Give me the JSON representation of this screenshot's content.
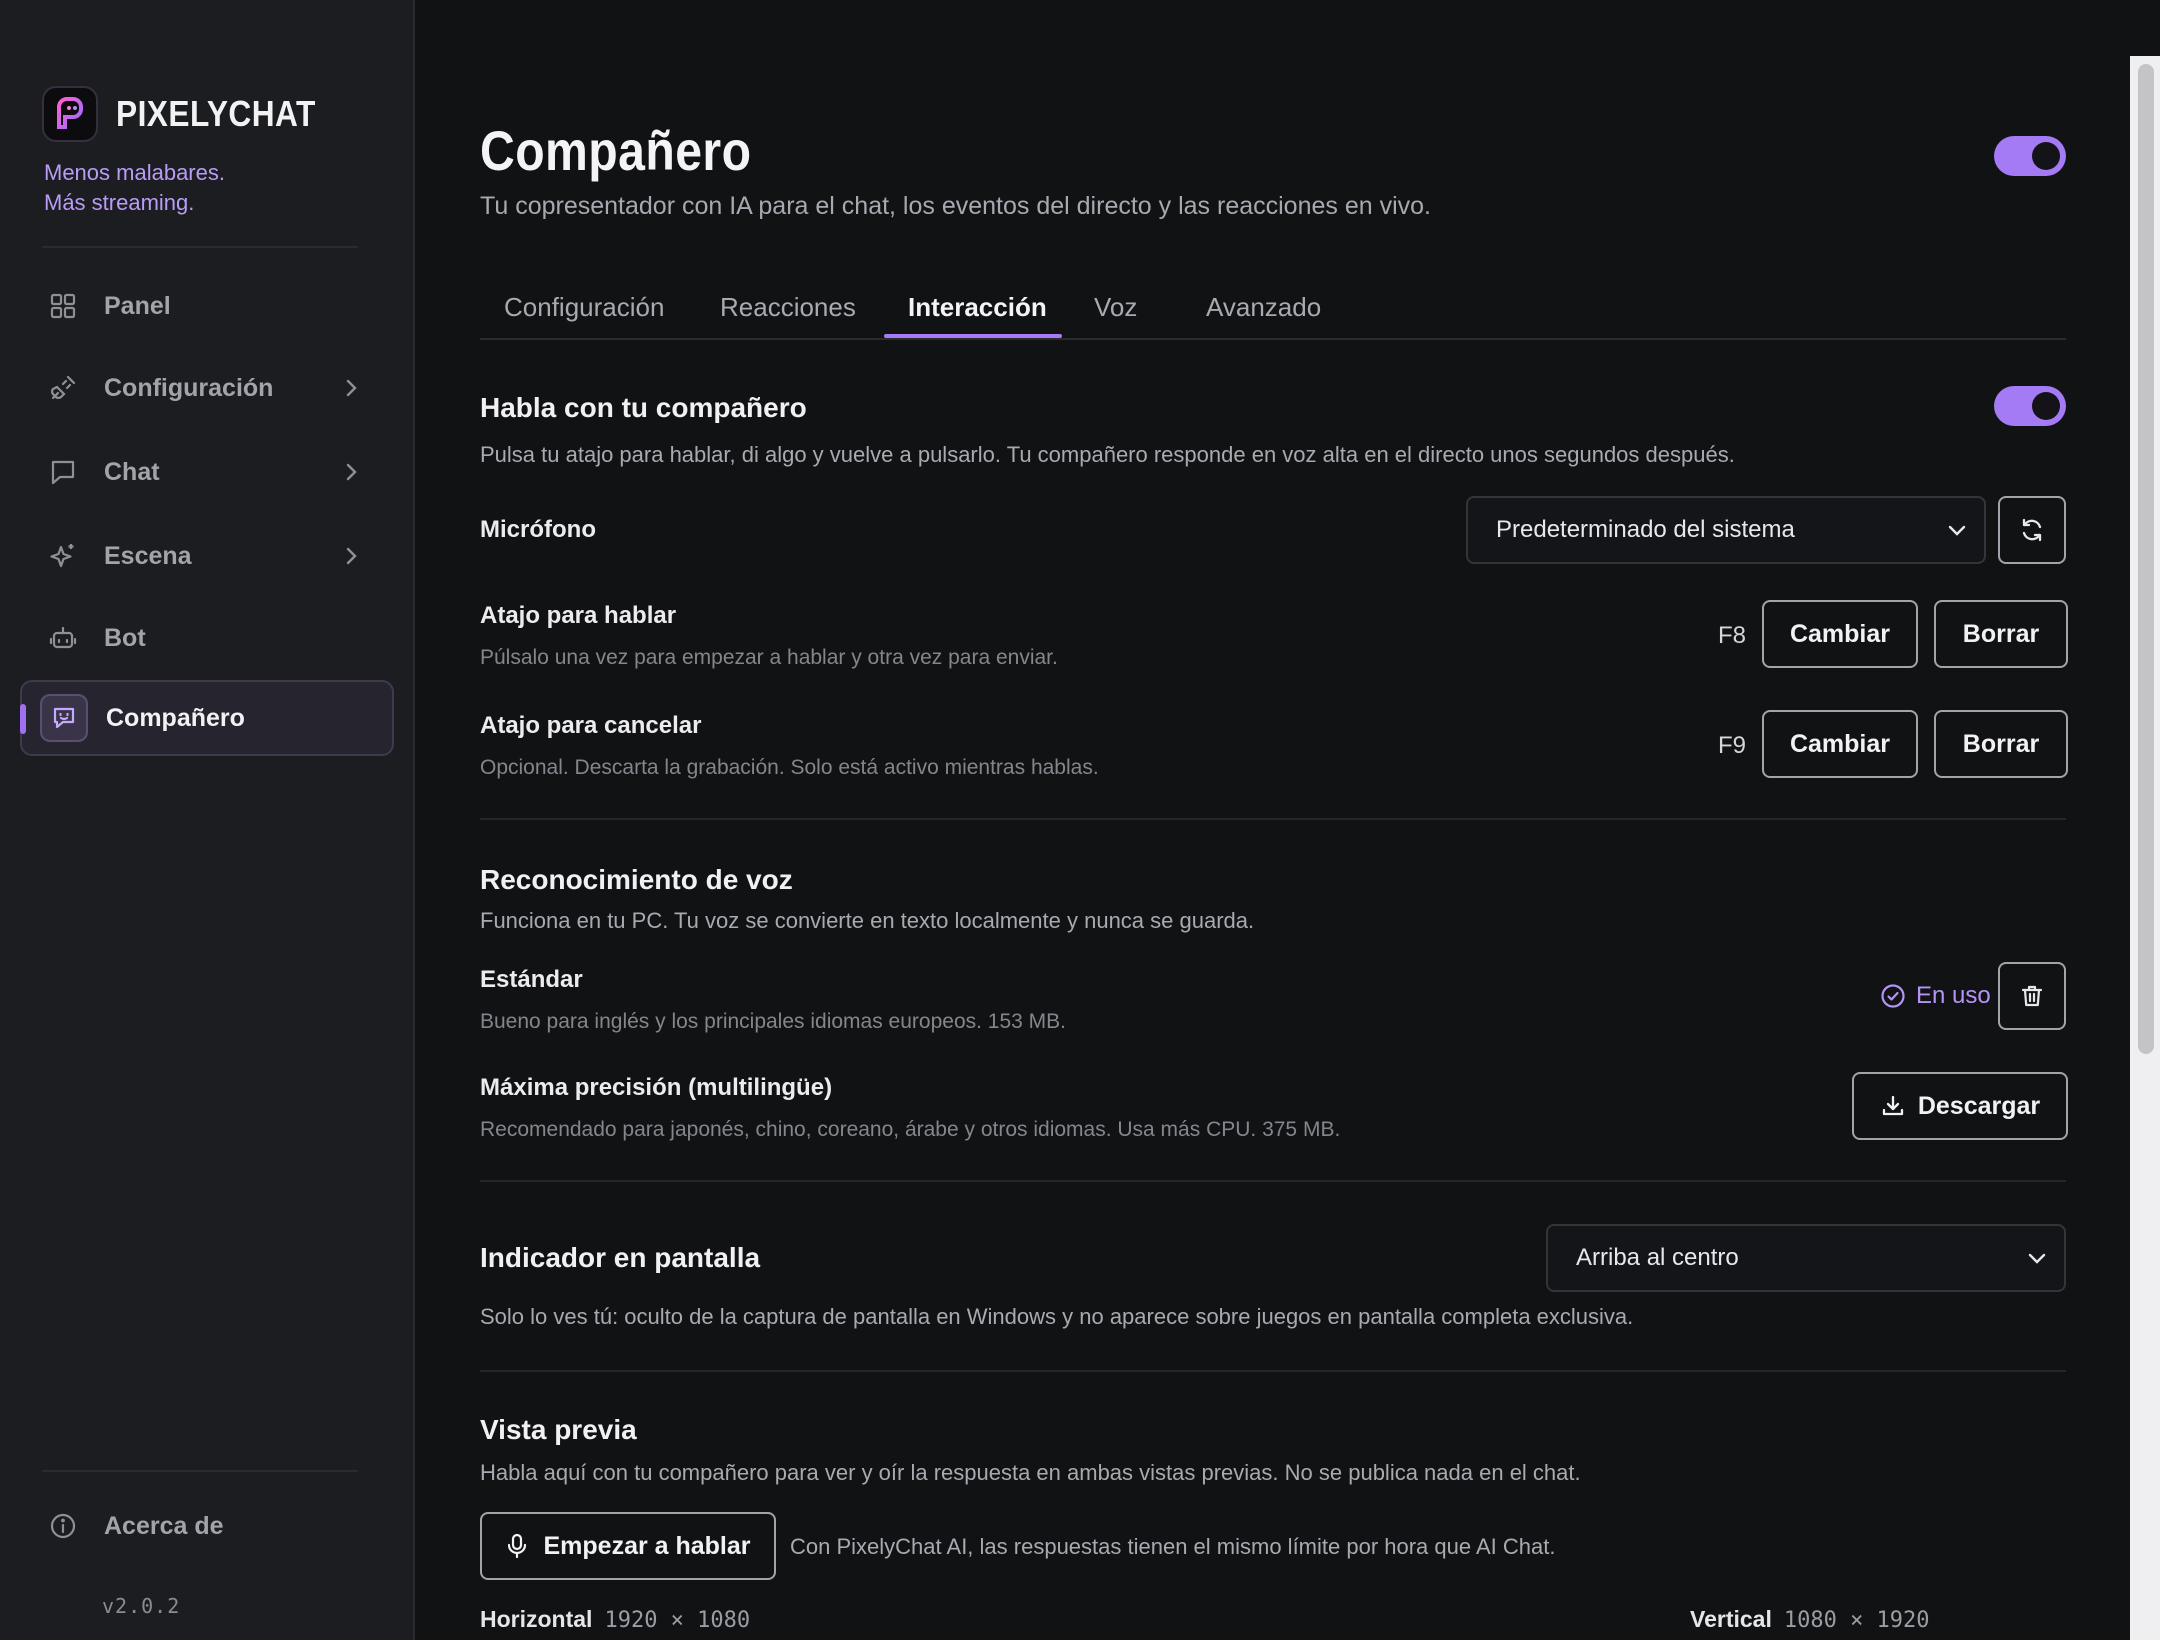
{
  "brand": {
    "name": "PIXELYCHAT",
    "tagline_line1": "Menos malabares.",
    "tagline_line2": "Más streaming."
  },
  "sidebar": {
    "items": [
      {
        "label": "Panel",
        "icon": "grid-icon"
      },
      {
        "label": "Configuración",
        "icon": "plug-icon"
      },
      {
        "label": "Chat",
        "icon": "chat-bubble-icon"
      },
      {
        "label": "Escena",
        "icon": "sparkle-icon"
      },
      {
        "label": "Bot",
        "icon": "robot-icon"
      },
      {
        "label": "Compañero",
        "icon": "companion-icon",
        "active": true
      }
    ],
    "about": "Acerca de",
    "version": "v2.0.2"
  },
  "page": {
    "title": "Compañero",
    "subtitle": "Tu copresentador con IA para el chat, los eventos del directo y las reacciones en vivo.",
    "enabled": true
  },
  "tabs": [
    "Configuración",
    "Reacciones",
    "Interacción",
    "Voz",
    "Avanzado"
  ],
  "active_tab": "Interacción",
  "talk": {
    "title": "Habla con tu compañero",
    "enabled": true,
    "description": "Pulsa tu atajo para hablar, di algo y vuelve a pulsarlo. Tu compañero responde en voz alta en el directo unos segundos después.",
    "mic_label": "Micrófono",
    "mic_value": "Predeterminado del sistema",
    "ptt_label": "Atajo para hablar",
    "ptt_desc": "Púlsalo una vez para empezar a hablar y otra vez para enviar.",
    "ptt_key": "F8",
    "cancel_label": "Atajo para cancelar",
    "cancel_desc": "Opcional. Descarta la grabación. Solo está activo mientras hablas.",
    "cancel_key": "F9",
    "change_label": "Cambiar",
    "clear_label": "Borrar"
  },
  "speech": {
    "title": "Reconocimiento de voz",
    "description": "Funciona en tu PC. Tu voz se convierte en texto localmente y nunca se guarda.",
    "standard_label": "Estándar",
    "standard_desc": "Bueno para inglés y los principales idiomas europeos. 153 MB.",
    "in_use": "En uso",
    "max_label": "Máxima precisión (multilingüe)",
    "max_desc": "Recomendado para japonés, chino, coreano, árabe y otros idiomas. Usa más CPU. 375 MB.",
    "download_label": "Descargar"
  },
  "indicator": {
    "title": "Indicador en pantalla",
    "value": "Arriba al centro",
    "description": "Solo lo ves tú: oculto de la captura de pantalla en Windows y no aparece sobre juegos en pantalla completa exclusiva."
  },
  "preview": {
    "title": "Vista previa",
    "description": "Habla aquí con tu compañero para ver y oír la respuesta en ambas vistas previas. No se publica nada en el chat.",
    "start_label": "Empezar a hablar",
    "note": "Con PixelyChat AI, las respuestas tienen el mismo límite por hora que AI Chat.",
    "horizontal_label": "Horizontal",
    "horizontal_res": "1920 × 1080",
    "vertical_label": "Vertical",
    "vertical_res": "1080 × 1920"
  },
  "colors": {
    "accent": "#a57af5",
    "background": "#111214",
    "sidebar": "#1c1d21"
  }
}
